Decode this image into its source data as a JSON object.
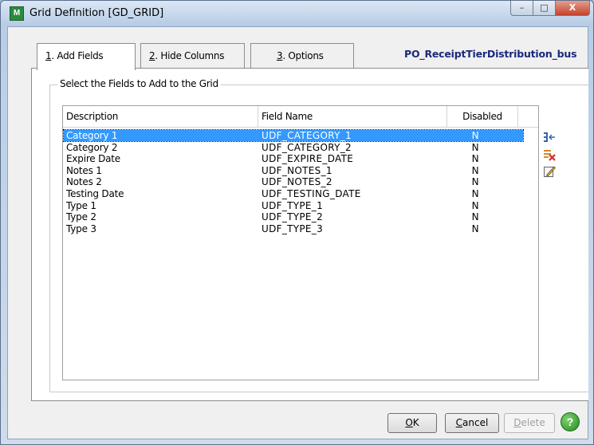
{
  "window": {
    "title": "Grid Definition  [GD_GRID]",
    "controls": {
      "minimize": "–",
      "maximize": "□",
      "close": "X"
    }
  },
  "tabs": [
    {
      "key": "1",
      "label": ". Add Fields"
    },
    {
      "key": "2",
      "label": ". Hide Columns"
    },
    {
      "key": "3",
      "label": ". Options"
    }
  ],
  "subtitle": "PO_ReceiptTierDistribution_bus",
  "group_label": "Select the Fields to Add to the Grid",
  "grid": {
    "columns": [
      "Description",
      "Field Name",
      "Disabled"
    ],
    "rows": [
      {
        "description": "Category 1",
        "field_name": "UDF_CATEGORY_1",
        "disabled": "N"
      },
      {
        "description": "Category 2",
        "field_name": "UDF_CATEGORY_2",
        "disabled": "N"
      },
      {
        "description": "Expire Date",
        "field_name": "UDF_EXPIRE_DATE",
        "disabled": "N"
      },
      {
        "description": "Notes 1",
        "field_name": "UDF_NOTES_1",
        "disabled": "N"
      },
      {
        "description": "Notes 2",
        "field_name": "UDF_NOTES_2",
        "disabled": "N"
      },
      {
        "description": "Testing Date",
        "field_name": "UDF_TESTING_DATE",
        "disabled": "N"
      },
      {
        "description": "Type 1",
        "field_name": "UDF_TYPE_1",
        "disabled": "N"
      },
      {
        "description": "Type 2",
        "field_name": "UDF_TYPE_2",
        "disabled": "N"
      },
      {
        "description": "Type 3",
        "field_name": "UDF_TYPE_3",
        "disabled": "N"
      }
    ],
    "selected_index": 0
  },
  "side_icons": [
    "add-field-icon",
    "delete-field-icon",
    "edit-field-icon"
  ],
  "buttons": {
    "ok_key": "O",
    "ok_rest": "K",
    "cancel_key": "C",
    "cancel_rest": "ancel",
    "delete_key": "D",
    "delete_rest": "elete",
    "help": "?"
  },
  "colors": {
    "selection": "#3399ff",
    "subtitle": "#1a2a7a"
  }
}
